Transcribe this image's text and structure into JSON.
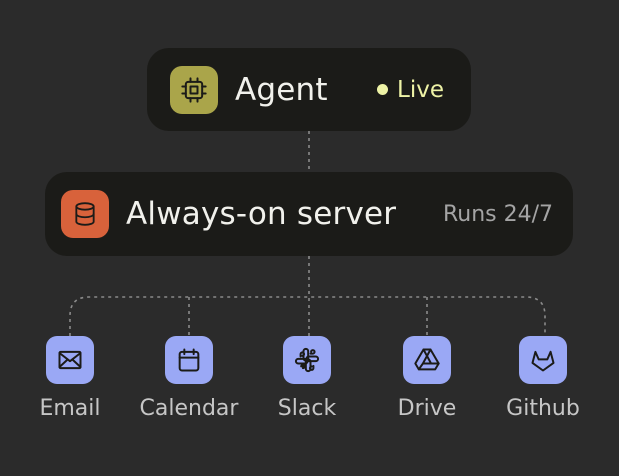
{
  "agent": {
    "title": "Agent",
    "status": "Live",
    "icon": "cpu-icon",
    "accent": "#aaa54a",
    "status_color": "#eef3a6"
  },
  "server": {
    "title": "Always-on server",
    "note": "Runs 24/7",
    "icon": "database-icon",
    "accent": "#d8623b"
  },
  "tools": [
    {
      "label": "Email",
      "icon": "mail-icon"
    },
    {
      "label": "Calendar",
      "icon": "calendar-icon"
    },
    {
      "label": "Slack",
      "icon": "slack-icon"
    },
    {
      "label": "Drive",
      "icon": "drive-icon"
    },
    {
      "label": "Github",
      "icon": "gitlab-icon"
    }
  ],
  "colors": {
    "background": "#2b2b2b",
    "card": "#1b1b18",
    "tool_tile": "#9aa8f5",
    "connector": "#8a8a8a"
  }
}
